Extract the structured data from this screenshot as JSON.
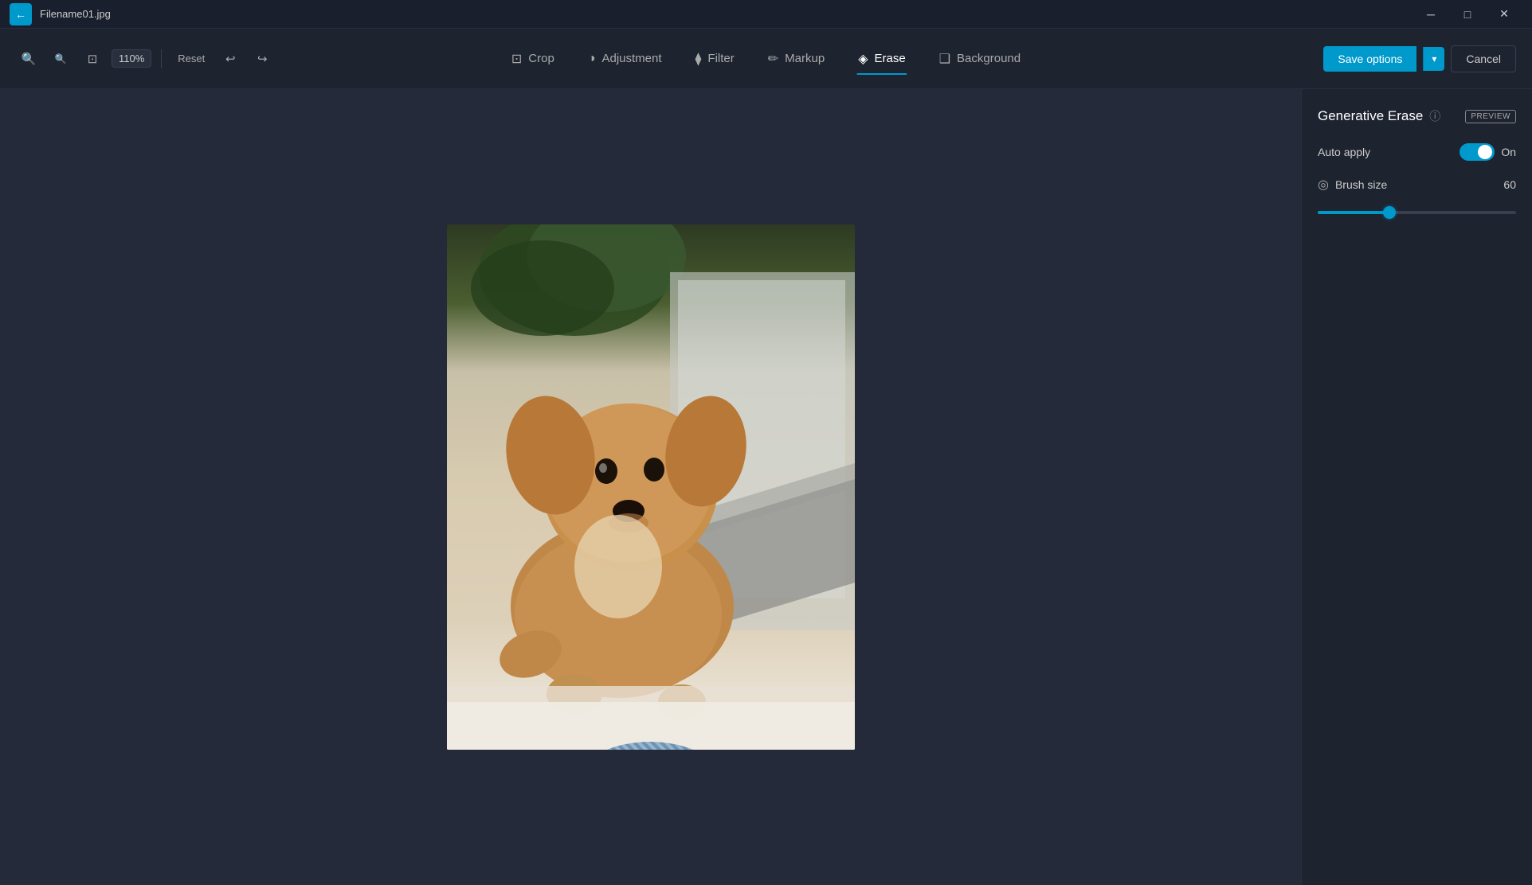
{
  "titlebar": {
    "filename": "Filename01.jpg",
    "minimize_label": "minimize",
    "maximize_label": "maximize",
    "close_label": "close",
    "back_icon": "←"
  },
  "toolbar": {
    "zoom_in_icon": "🔍",
    "zoom_out_icon": "🔍",
    "fit_icon": "⊡",
    "zoom_value": "110%",
    "reset_label": "Reset",
    "undo_icon": "↩",
    "redo_icon": "↪"
  },
  "nav": {
    "tabs": [
      {
        "id": "crop",
        "label": "Crop",
        "icon": "⊡",
        "active": false
      },
      {
        "id": "adjustment",
        "label": "Adjustment",
        "icon": "◑",
        "active": false
      },
      {
        "id": "filter",
        "label": "Filter",
        "icon": "⧫",
        "active": false
      },
      {
        "id": "markup",
        "label": "Markup",
        "icon": "✏",
        "active": false
      },
      {
        "id": "erase",
        "label": "Erase",
        "icon": "◈",
        "active": true
      },
      {
        "id": "background",
        "label": "Background",
        "icon": "❑",
        "active": false
      }
    ]
  },
  "toolbar_right": {
    "save_options_label": "Save options",
    "cancel_label": "Cancel"
  },
  "right_panel": {
    "title": "Generative Erase",
    "info_icon": "ⓘ",
    "preview_label": "PREVIEW",
    "auto_apply_label": "Auto apply",
    "toggle_state": "On",
    "brush_size_label": "Brush size",
    "brush_size_value": "60",
    "slider_percent": 35
  }
}
